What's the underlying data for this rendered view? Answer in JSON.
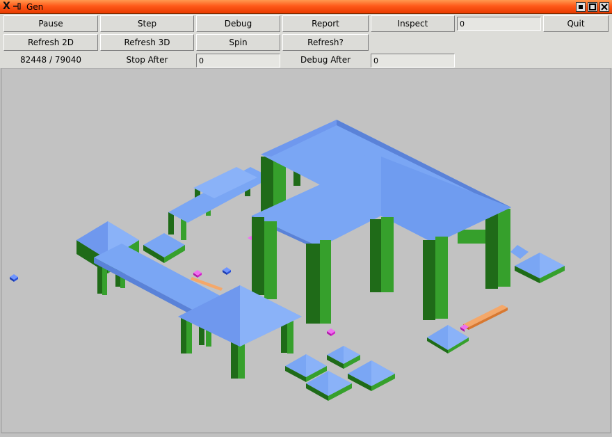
{
  "window": {
    "title": "Gen"
  },
  "toolbar": {
    "pause": "Pause",
    "step": "Step",
    "debug": "Debug",
    "report": "Report",
    "inspect": "Inspect",
    "inspect_value": "0",
    "quit": "Quit",
    "refresh_2d": "Refresh 2D",
    "refresh_3d": "Refresh 3D",
    "spin": "Spin",
    "refresh_q": "Refresh?"
  },
  "status": {
    "counter": "82448 / 79040",
    "stop_after_label": "Stop After",
    "stop_after_value": "0",
    "debug_after_label": "Debug After",
    "debug_after_value": "0"
  },
  "colors": {
    "roof": "#7aa6f4",
    "roof_dark": "#5a82d8",
    "pillar": "#36a02c",
    "pillar_dark": "#1f6b18",
    "background": "#c0c0c0",
    "beam": "#f0a060",
    "marker_magenta": "#e030d0",
    "marker_blue": "#2050e0"
  },
  "icons": [
    "x-logo-icon",
    "pin-icon",
    "minimize-icon",
    "maximize-icon",
    "close-icon"
  ]
}
